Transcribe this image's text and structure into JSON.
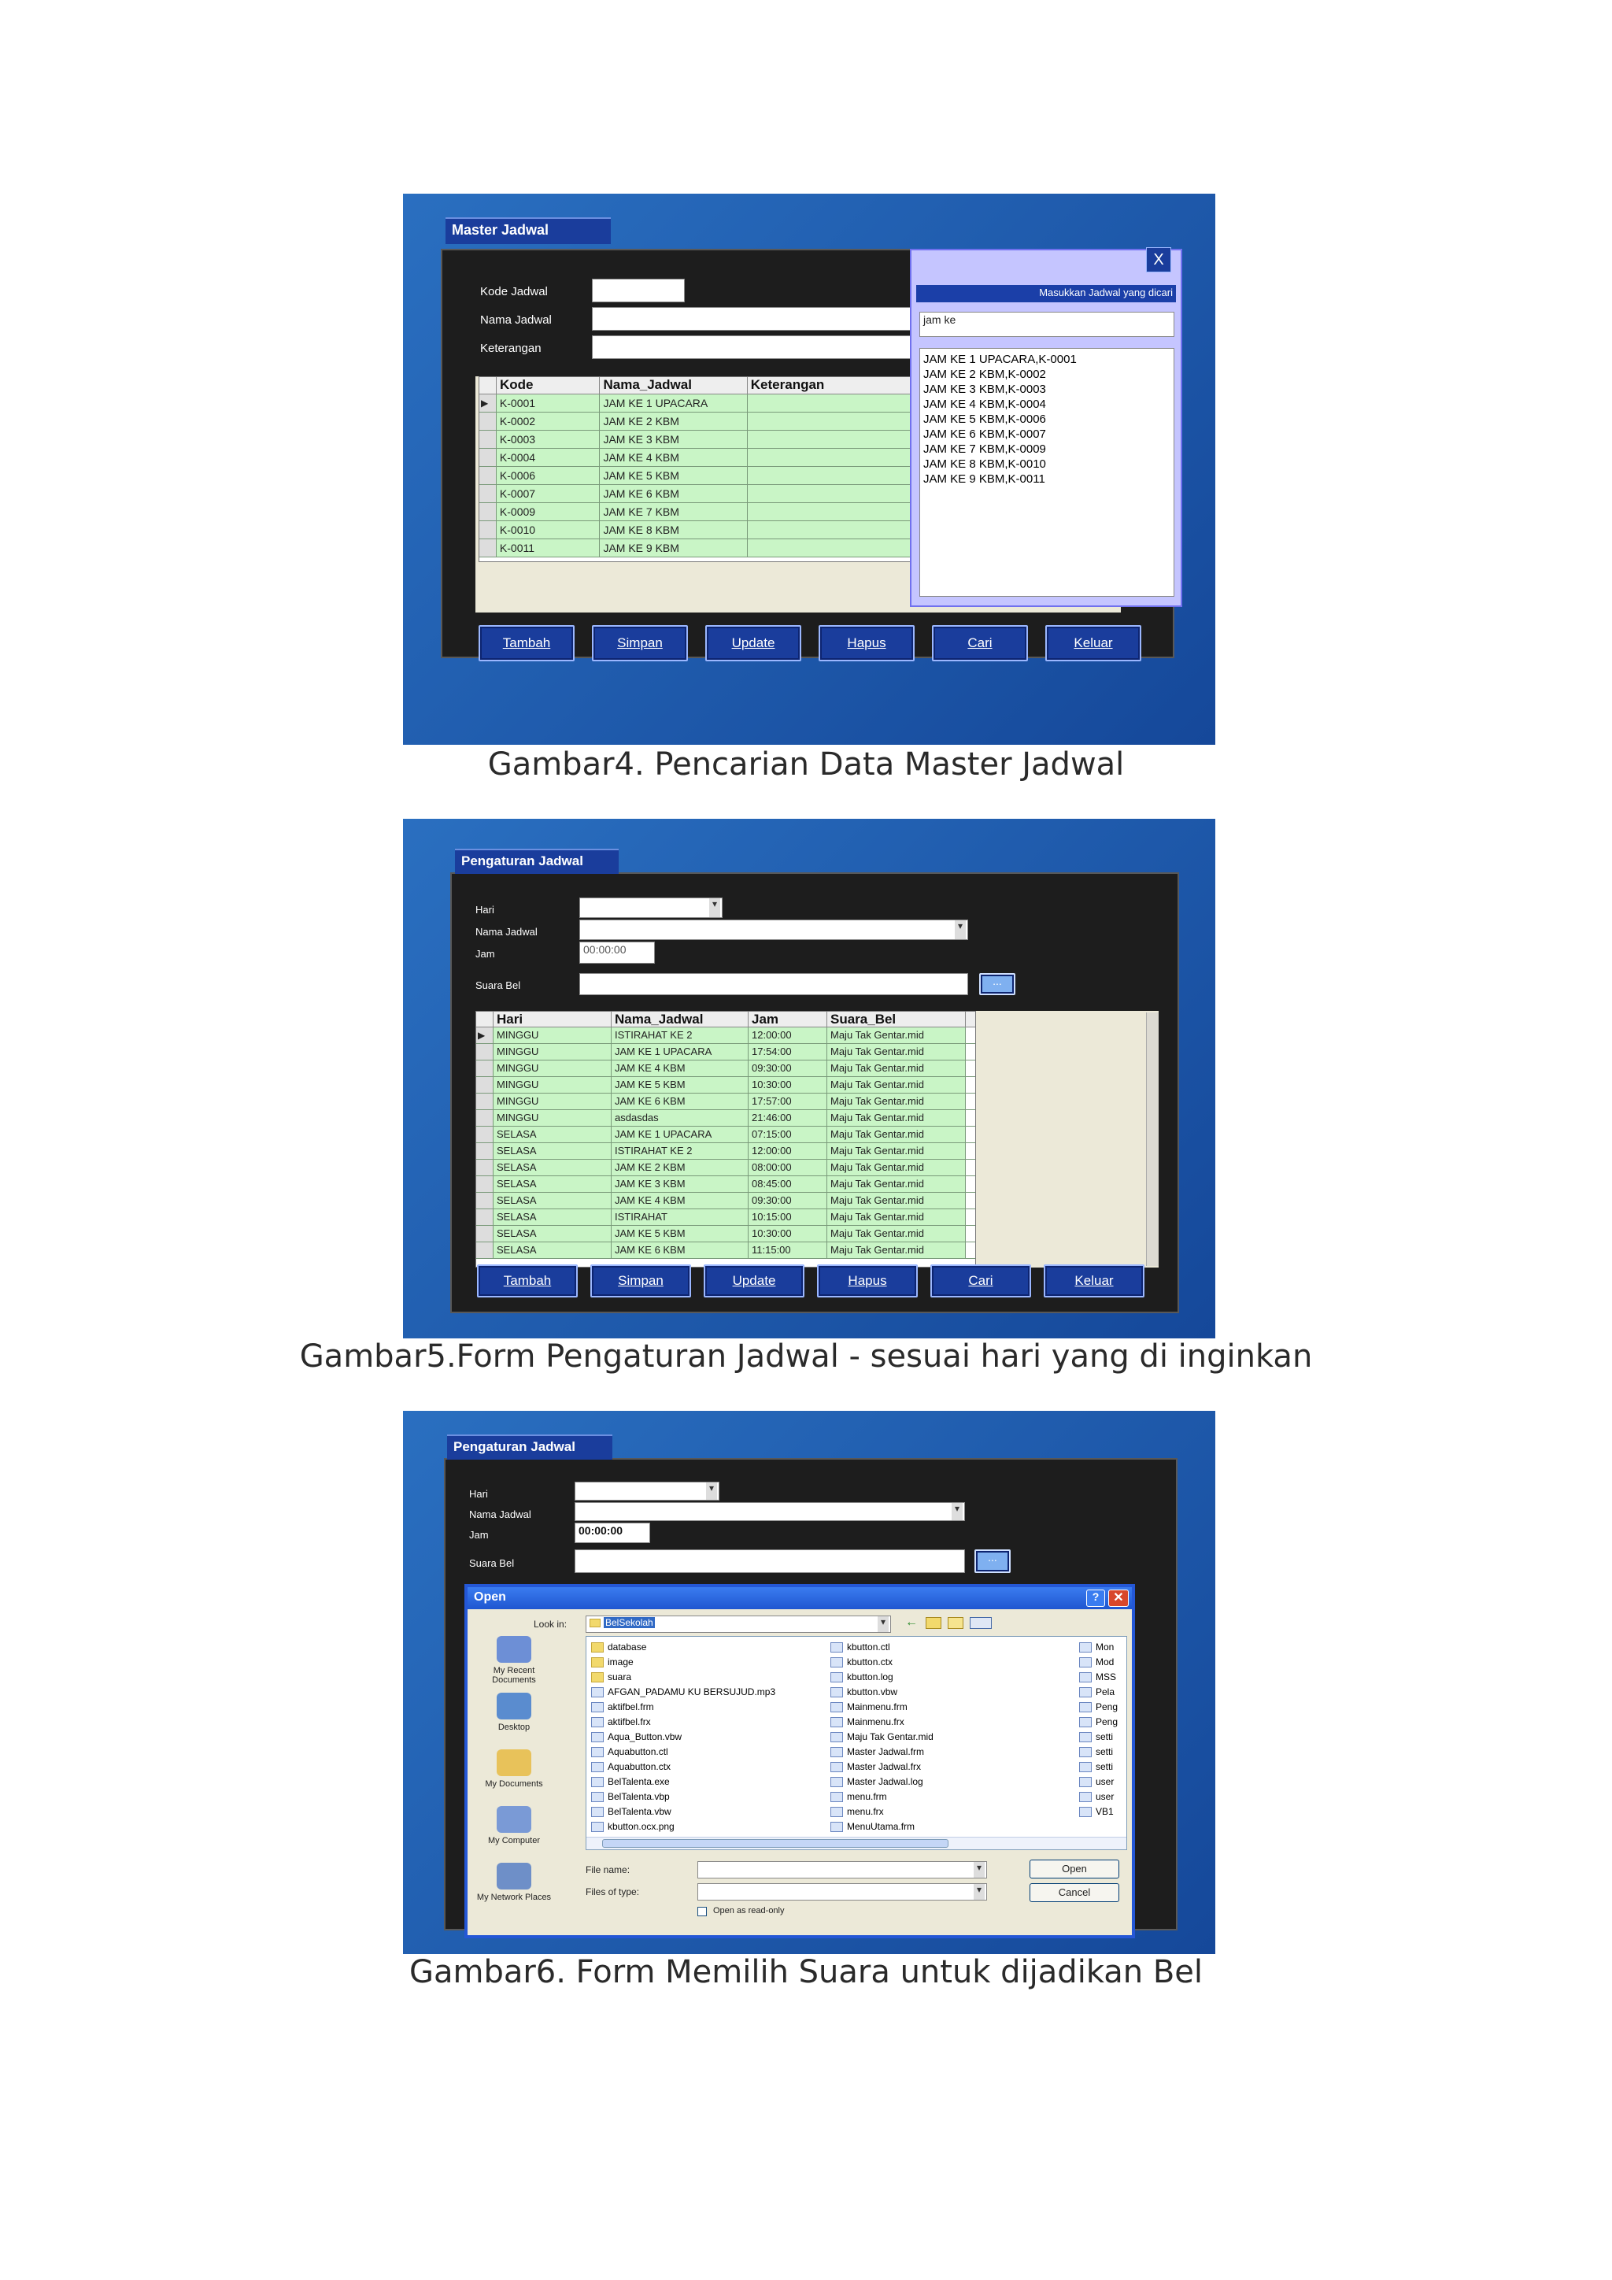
{
  "figures": [
    {
      "caption": "Gambar4. Pencarian Data Master Jadwal",
      "window_title": "Master Jadwal",
      "labels": [
        "Kode Jadwal",
        "Nama Jadwal",
        "Keterangan"
      ],
      "columns": [
        "Kode",
        "Nama_Jadwal",
        "Keterangan"
      ],
      "rows": [
        [
          "K-0001",
          "JAM KE 1 UPACARA",
          ""
        ],
        [
          "K-0002",
          "JAM KE 2 KBM",
          ""
        ],
        [
          "K-0003",
          "JAM KE 3 KBM",
          ""
        ],
        [
          "K-0004",
          "JAM KE 4 KBM",
          ""
        ],
        [
          "K-0006",
          "JAM KE 5 KBM",
          ""
        ],
        [
          "K-0007",
          "JAM KE 6 KBM",
          ""
        ],
        [
          "K-0009",
          "JAM KE 7 KBM",
          ""
        ],
        [
          "K-0010",
          "JAM KE 8 KBM",
          ""
        ],
        [
          "K-0011",
          "JAM KE 9 KBM",
          ""
        ]
      ],
      "search_panel": {
        "title": "Masukkan Jadwal yang dicari",
        "close": "X",
        "query": "jam ke",
        "results": [
          "JAM KE 1 UPACARA,K-0001",
          "JAM KE 2 KBM,K-0002",
          "JAM KE 3 KBM,K-0003",
          "JAM KE 4 KBM,K-0004",
          "JAM KE 5 KBM,K-0006",
          "JAM KE 6 KBM,K-0007",
          "JAM KE 7 KBM,K-0009",
          "JAM KE 8 KBM,K-0010",
          "JAM KE 9 KBM,K-0011"
        ]
      },
      "buttons": [
        "Tambah",
        "Simpan",
        "Update",
        "Hapus",
        "Cari",
        "Keluar"
      ]
    },
    {
      "caption": "Gambar5.Form Pengaturan Jadwal - sesuai hari yang di inginkan",
      "window_title": "Pengaturan Jadwal",
      "labels": [
        "Hari",
        "Nama Jadwal",
        "Jam",
        "Suara Bel"
      ],
      "jam_value": "00:00:00",
      "browse": "...",
      "columns": [
        "Hari",
        "Nama_Jadwal",
        "Jam",
        "Suara_Bel"
      ],
      "rows": [
        [
          "MINGGU",
          "ISTIRAHAT KE 2",
          "12:00:00",
          "Maju Tak Gentar.mid"
        ],
        [
          "MINGGU",
          "JAM KE 1 UPACARA",
          "17:54:00",
          "Maju Tak Gentar.mid"
        ],
        [
          "MINGGU",
          "JAM KE 4 KBM",
          "09:30:00",
          "Maju Tak Gentar.mid"
        ],
        [
          "MINGGU",
          "JAM KE 5 KBM",
          "10:30:00",
          "Maju Tak Gentar.mid"
        ],
        [
          "MINGGU",
          "JAM KE 6 KBM",
          "17:57:00",
          "Maju Tak Gentar.mid"
        ],
        [
          "MINGGU",
          "asdasdas",
          "21:46:00",
          "Maju Tak Gentar.mid"
        ],
        [
          "SELASA",
          "JAM KE 1 UPACARA",
          "07:15:00",
          "Maju Tak Gentar.mid"
        ],
        [
          "SELASA",
          "ISTIRAHAT KE 2",
          "12:00:00",
          "Maju Tak Gentar.mid"
        ],
        [
          "SELASA",
          "JAM KE 2 KBM",
          "08:00:00",
          "Maju Tak Gentar.mid"
        ],
        [
          "SELASA",
          "JAM KE 3 KBM",
          "08:45:00",
          "Maju Tak Gentar.mid"
        ],
        [
          "SELASA",
          "JAM KE 4 KBM",
          "09:30:00",
          "Maju Tak Gentar.mid"
        ],
        [
          "SELASA",
          "ISTIRAHAT",
          "10:15:00",
          "Maju Tak Gentar.mid"
        ],
        [
          "SELASA",
          "JAM KE 5 KBM",
          "10:30:00",
          "Maju Tak Gentar.mid"
        ],
        [
          "SELASA",
          "JAM KE 6 KBM",
          "11:15:00",
          "Maju Tak Gentar.mid"
        ]
      ],
      "buttons": [
        "Tambah",
        "Simpan",
        "Update",
        "Hapus",
        "Cari",
        "Keluar"
      ]
    },
    {
      "caption": "Gambar6. Form Memilih Suara untuk  dijadikan Bel",
      "window_title": "Pengaturan Jadwal",
      "labels": [
        "Hari",
        "Nama Jadwal",
        "Jam",
        "Suara Bel"
      ],
      "jam_value": "00:00:00",
      "browse": "...",
      "dialog": {
        "title": "Open",
        "look_in_label": "Look in:",
        "look_in_value": "BelSekolah",
        "places": [
          "My Recent Documents",
          "Desktop",
          "My Documents",
          "My Computer",
          "My Network Places"
        ],
        "col1": [
          "database",
          "image",
          "suara",
          "AFGAN_PADAMU KU BERSUJUD.mp3",
          "aktifbel.frm",
          "aktifbel.frx",
          "Aqua_Button.vbw",
          "Aquabutton.ctl",
          "Aquabutton.ctx",
          "BelTalenta.exe",
          "BelTalenta.vbp",
          "BelTalenta.vbw",
          "kbutton.ocx.png"
        ],
        "col2": [
          "kbutton.ctl",
          "kbutton.ctx",
          "kbutton.log",
          "kbutton.vbw",
          "Mainmenu.frm",
          "Mainmenu.frx",
          "Maju Tak Gentar.mid",
          "Master Jadwal.frm",
          "Master Jadwal.frx",
          "Master Jadwal.log",
          "menu.frm",
          "menu.frx",
          "MenuUtama.frm"
        ],
        "col3": [
          "Mon",
          "Mod",
          "MSS",
          "Pela",
          "Peng",
          "Peng",
          "setti",
          "setti",
          "setti",
          "user",
          "user",
          "VB1"
        ],
        "file_name_label": "File name:",
        "file_type_label": "Files of type:",
        "readonly_label": "Open as read-only",
        "open_button": "Open",
        "cancel_button": "Cancel"
      }
    }
  ]
}
